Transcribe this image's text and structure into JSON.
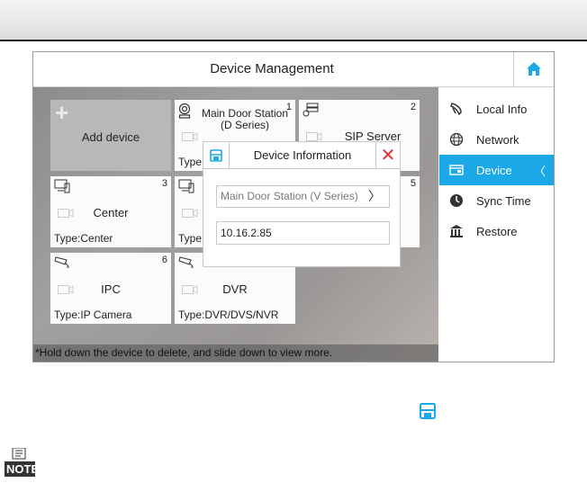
{
  "window": {
    "title": "Device Management"
  },
  "tiles": [
    {
      "label": "Add device"
    },
    {
      "num": "1",
      "name": "Main Door Station (D Series)",
      "type": "Type:"
    },
    {
      "num": "2",
      "name": "SIP Server",
      "type": ""
    },
    {
      "num": "3",
      "name": "Center",
      "type": "Type:Center"
    },
    {
      "num": "",
      "name": "",
      "type": "Type"
    },
    {
      "num": "5",
      "name": "",
      "type": ""
    },
    {
      "num": "6",
      "name": "IPC",
      "type": "Type:IP Camera"
    },
    {
      "num": "",
      "name": "DVR",
      "type": "Type:DVR/DVS/NVR"
    }
  ],
  "footer_note": "*Hold down the device to delete, and slide down to view more.",
  "sidebar": {
    "items": [
      {
        "label": "Local Info",
        "icon": "local-info-icon"
      },
      {
        "label": "Network",
        "icon": "network-icon"
      },
      {
        "label": "Device",
        "icon": "device-icon",
        "active": true
      },
      {
        "label": "Sync Time",
        "icon": "clock-icon"
      },
      {
        "label": "Restore",
        "icon": "restore-icon"
      }
    ],
    "chevron": "〈"
  },
  "dialog": {
    "title": "Device Information",
    "device_type": "Main Door Station (V Series)",
    "select_arrow": "〉",
    "ip_address": "10.16.2.85",
    "close_glyph": "✕"
  },
  "colors": {
    "accent": "#1aa9e6",
    "close": "#e03030"
  },
  "note_label": "NOTE"
}
